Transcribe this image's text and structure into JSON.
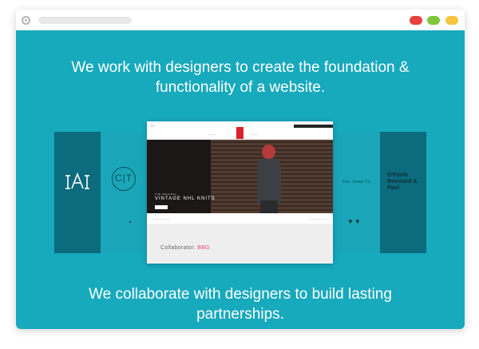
{
  "window": {
    "controls": [
      "close",
      "minimize",
      "maximize"
    ],
    "control_colors": {
      "red": "#e8413f",
      "green": "#7ec73c",
      "yellow": "#f6c53d"
    }
  },
  "content": {
    "background": "#17a9bc",
    "headline_top": "We work with designers to create the foundation & functionality of a website.",
    "headline_bottom": "We collaborate with designers to build lasting partnerships."
  },
  "carousel": {
    "logos": [
      {
        "id": "iai",
        "text": "IAI"
      },
      {
        "id": "ct",
        "text": "C|T"
      },
      {
        "id": "eol",
        "text": "Eve. Some Co."
      },
      {
        "id": "ors",
        "text": "O'Keefe Reinhard & Paul"
      }
    ],
    "featured": {
      "hero_kicker": "THE ORIGINAL",
      "hero_title": "VINTAGE NHL KNITS",
      "collaborator_label": "Collaborator:",
      "collaborator_name": "BBG"
    }
  }
}
